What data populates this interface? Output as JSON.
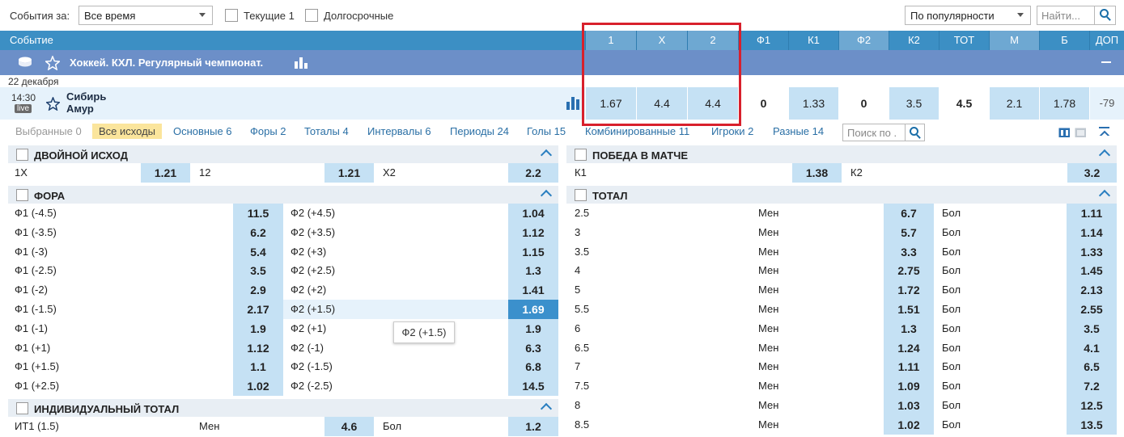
{
  "filter": {
    "events_for_label": "События за:",
    "period_value": "Все время",
    "current_label": "Текущие 1",
    "longterm_label": "Долгосрочные",
    "sort_value": "По популярности",
    "search_placeholder": "Найти..."
  },
  "header": {
    "event_label": "Событие",
    "columns": [
      "1",
      "X",
      "2",
      "Ф1",
      "К1",
      "Ф2",
      "К2",
      "ТОТ",
      "М",
      "Б",
      "ДОП"
    ]
  },
  "championship": {
    "title": "Хоккей. КХЛ. Регулярный чемпионат."
  },
  "date": "22 декабря",
  "event": {
    "time": "14:30",
    "live": "live",
    "team1": "Сибирь",
    "team2": "Амур",
    "odds": [
      "1.67",
      "4.4",
      "4.4",
      "0",
      "1.33",
      "0",
      "3.5",
      "4.5",
      "2.1",
      "1.78",
      "-79"
    ]
  },
  "tabs": {
    "chosen": "Выбранные 0",
    "all": "Все исходы",
    "main": "Основные 6",
    "handicaps": "Форы 2",
    "totals": "Тоталы 4",
    "intervals": "Интервалы 6",
    "periods": "Периоды 24",
    "goals": "Голы 15",
    "combined": "Комбинированные 11",
    "players": "Игроки 2",
    "misc": "Разные 14",
    "search_placeholder": "Поиск по ."
  },
  "double_chance": {
    "title": "ДВОЙНОЙ ИСХОД",
    "items": [
      {
        "label": "1X",
        "value": "1.21"
      },
      {
        "label": "12",
        "value": "1.21"
      },
      {
        "label": "X2",
        "value": "2.2"
      }
    ]
  },
  "match_win": {
    "title": "ПОБЕДА В МАТЧЕ",
    "items": [
      {
        "label": "К1",
        "value": "1.38"
      },
      {
        "label": "К2",
        "value": "3.2"
      }
    ]
  },
  "handicap": {
    "title": "ФОРА",
    "rows": [
      {
        "l1": "Ф1 (-4.5)",
        "v1": "11.5",
        "l2": "Ф2 (+4.5)",
        "v2": "1.04"
      },
      {
        "l1": "Ф1 (-3.5)",
        "v1": "6.2",
        "l2": "Ф2 (+3.5)",
        "v2": "1.12"
      },
      {
        "l1": "Ф1 (-3)",
        "v1": "5.4",
        "l2": "Ф2 (+3)",
        "v2": "1.15"
      },
      {
        "l1": "Ф1 (-2.5)",
        "v1": "3.5",
        "l2": "Ф2 (+2.5)",
        "v2": "1.3"
      },
      {
        "l1": "Ф1 (-2)",
        "v1": "2.9",
        "l2": "Ф2 (+2)",
        "v2": "1.41"
      },
      {
        "l1": "Ф1 (-1.5)",
        "v1": "2.17",
        "l2": "Ф2 (+1.5)",
        "v2": "1.69"
      },
      {
        "l1": "Ф1 (-1)",
        "v1": "1.9",
        "l2": "Ф2 (+1)",
        "v2": "1.9"
      },
      {
        "l1": "Ф1 (+1)",
        "v1": "1.12",
        "l2": "Ф2 (-1)",
        "v2": "6.3"
      },
      {
        "l1": "Ф1 (+1.5)",
        "v1": "1.1",
        "l2": "Ф2 (-1.5)",
        "v2": "6.8"
      },
      {
        "l1": "Ф1 (+2.5)",
        "v1": "1.02",
        "l2": "Ф2 (-2.5)",
        "v2": "14.5"
      }
    ],
    "tooltip": "Ф2 (+1.5)"
  },
  "total": {
    "title": "ТОТАЛ",
    "under_label": "Мен",
    "over_label": "Бол",
    "rows": [
      {
        "line": "2.5",
        "under": "6.7",
        "over": "1.11"
      },
      {
        "line": "3",
        "under": "5.7",
        "over": "1.14"
      },
      {
        "line": "3.5",
        "under": "3.3",
        "over": "1.33"
      },
      {
        "line": "4",
        "under": "2.75",
        "over": "1.45"
      },
      {
        "line": "5",
        "under": "1.72",
        "over": "2.13"
      },
      {
        "line": "5.5",
        "under": "1.51",
        "over": "2.55"
      },
      {
        "line": "6",
        "under": "1.3",
        "over": "3.5"
      },
      {
        "line": "6.5",
        "under": "1.24",
        "over": "4.1"
      },
      {
        "line": "7",
        "under": "1.11",
        "over": "6.5"
      },
      {
        "line": "7.5",
        "under": "1.09",
        "over": "7.2"
      },
      {
        "line": "8",
        "under": "1.03",
        "over": "12.5"
      },
      {
        "line": "8.5",
        "under": "1.02",
        "over": "13.5"
      }
    ]
  },
  "individual_total": {
    "title": "ИНДИВИДУАЛЬНЫЙ ТОТАЛ",
    "rows": [
      {
        "label": "ИТ1 (1.5)",
        "under_label": "Мен",
        "under": "4.6",
        "over_label": "Бол",
        "over": "1.2"
      }
    ]
  },
  "colors": {
    "header_blue": "#3c8fc4",
    "champ_blue": "#6c8fc8",
    "odds_cell": "#c5e1f4",
    "highlight": "#3b90cc",
    "red_box": "#d8202c",
    "tab_selected": "#fbe59c"
  }
}
